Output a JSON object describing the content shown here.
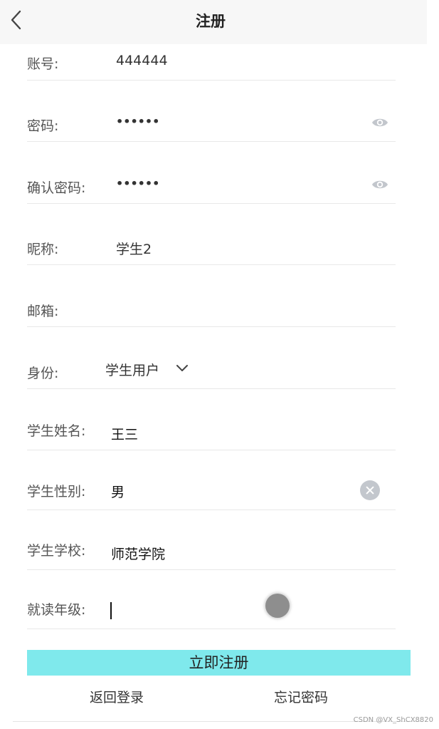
{
  "header": {
    "title": "注册",
    "back_icon": "chevron-left-icon"
  },
  "form": {
    "account": {
      "label": "账号:",
      "value": "444444"
    },
    "password": {
      "label": "密码:",
      "value": "••••••",
      "icon": "eye-icon"
    },
    "confirm_password": {
      "label": "确认密码:",
      "value": "••••••",
      "icon": "eye-icon"
    },
    "nickname": {
      "label": "昵称:",
      "value": "学生2"
    },
    "email": {
      "label": "邮箱:",
      "value": ""
    },
    "identity": {
      "label": "身份:",
      "value": "学生用户",
      "icon": "chevron-down-icon"
    },
    "student_name": {
      "label": "学生姓名:",
      "value": "王三"
    },
    "student_gender": {
      "label": "学生性别:",
      "value": "男",
      "icon": "clear-icon"
    },
    "student_school": {
      "label": "学生学校:",
      "value": "师范学院"
    },
    "grade": {
      "label": "就读年级:",
      "value": ""
    }
  },
  "actions": {
    "register_label": "立即注册",
    "back_login_label": "返回登录",
    "forgot_password_label": "忘记密码"
  },
  "colors": {
    "register_button": "#7fe9ec",
    "navbar": "#f7f7f7",
    "divider": "#e8e8e8"
  },
  "watermark": "CSDN @VX_ShCX8820"
}
